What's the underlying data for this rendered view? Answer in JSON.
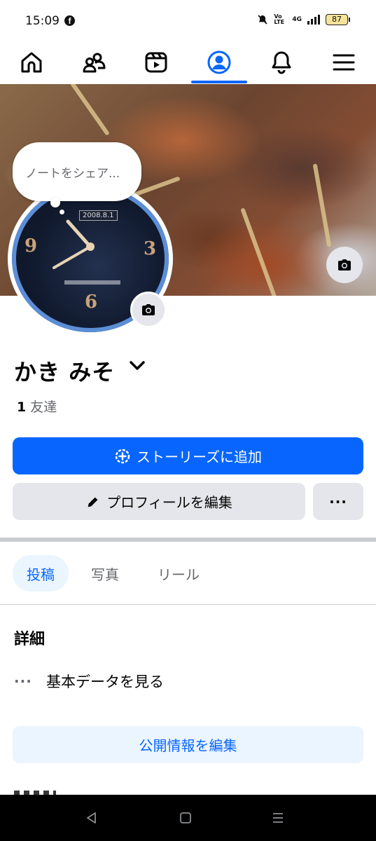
{
  "status_bar": {
    "time": "15:09",
    "app_icon": "facebook-icon",
    "volte": "Vo LTE",
    "network": "4G",
    "battery": "87"
  },
  "nav": {
    "items": [
      {
        "name": "home-icon"
      },
      {
        "name": "friends-icon"
      },
      {
        "name": "video-icon"
      },
      {
        "name": "profile-icon",
        "active": true
      },
      {
        "name": "bell-icon"
      },
      {
        "name": "menu-icon"
      }
    ],
    "accent_color": "#0866ff"
  },
  "cover": {
    "camera_icon": "camera-icon"
  },
  "avatar": {
    "note_placeholder": "ノートをシェア...",
    "watch_date": "2008.8.1",
    "dial_numbers": [
      "9",
      "3",
      "6"
    ],
    "camera_icon": "camera-icon"
  },
  "profile": {
    "name": "かき みそ",
    "friend_count": "1",
    "friend_label": "友達"
  },
  "actions": {
    "add_story": "ストーリーズに追加",
    "edit_profile": "プロフィールを編集",
    "more": "···"
  },
  "tabs": [
    {
      "label": "投稿",
      "active": true
    },
    {
      "label": "写真"
    },
    {
      "label": "リール"
    }
  ],
  "details": {
    "title": "詳細",
    "basic_info": "基本データを見る",
    "dots": "···",
    "edit_public": "公開情報を編集"
  },
  "colors": {
    "primary": "#0866ff",
    "secondary_bg": "#e4e6eb",
    "light_blue_bg": "#ebf5ff",
    "text_secondary": "#65676b"
  }
}
